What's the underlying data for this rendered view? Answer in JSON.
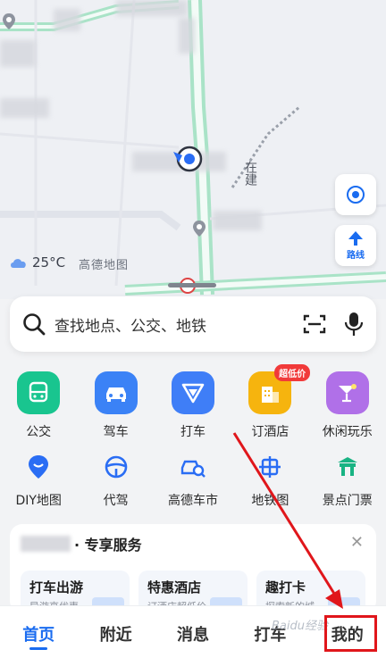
{
  "map": {
    "weather": "25°C",
    "brand": "高德地图",
    "street_label": "在建",
    "route_button_label": "路线",
    "colors": {
      "road": "#a9e3c7",
      "background": "#eef0f4"
    }
  },
  "search": {
    "placeholder": "查找地点、公交、地铁"
  },
  "shortcuts_row1": [
    {
      "label": "公交",
      "icon": "bus-icon",
      "color": "#19c58f"
    },
    {
      "label": "驾车",
      "icon": "car-icon",
      "color": "#3b82f6"
    },
    {
      "label": "打车",
      "icon": "taxi-icon",
      "color": "#3f7ef7"
    },
    {
      "label": "订酒店",
      "icon": "hotel-icon",
      "color": "#f6b40e",
      "badge": "超低价"
    },
    {
      "label": "休闲玩乐",
      "icon": "cocktail-icon",
      "color": "#b070e8"
    }
  ],
  "shortcuts_row2": [
    {
      "label": "DIY地图",
      "icon": "map-pin-icon"
    },
    {
      "label": "代驾",
      "icon": "steering-wheel-icon"
    },
    {
      "label": "高德车市",
      "icon": "car-search-icon"
    },
    {
      "label": "地铁图",
      "icon": "subway-icon"
    },
    {
      "label": "景点门票",
      "icon": "gate-icon"
    }
  ],
  "exclusive": {
    "title": "· 专享服务",
    "cards": [
      {
        "title": "打车出游",
        "desc": "导游享优惠"
      },
      {
        "title": "特惠酒店",
        "desc": "订酒店超低价"
      },
      {
        "title": "趣打卡",
        "desc": "探索新的城"
      }
    ]
  },
  "tabs": [
    {
      "label": "首页",
      "active": true
    },
    {
      "label": "附近",
      "active": false
    },
    {
      "label": "消息",
      "active": false
    },
    {
      "label": "打车",
      "active": false
    },
    {
      "label": "我的",
      "active": false
    }
  ],
  "watermark": "Baidu经验"
}
